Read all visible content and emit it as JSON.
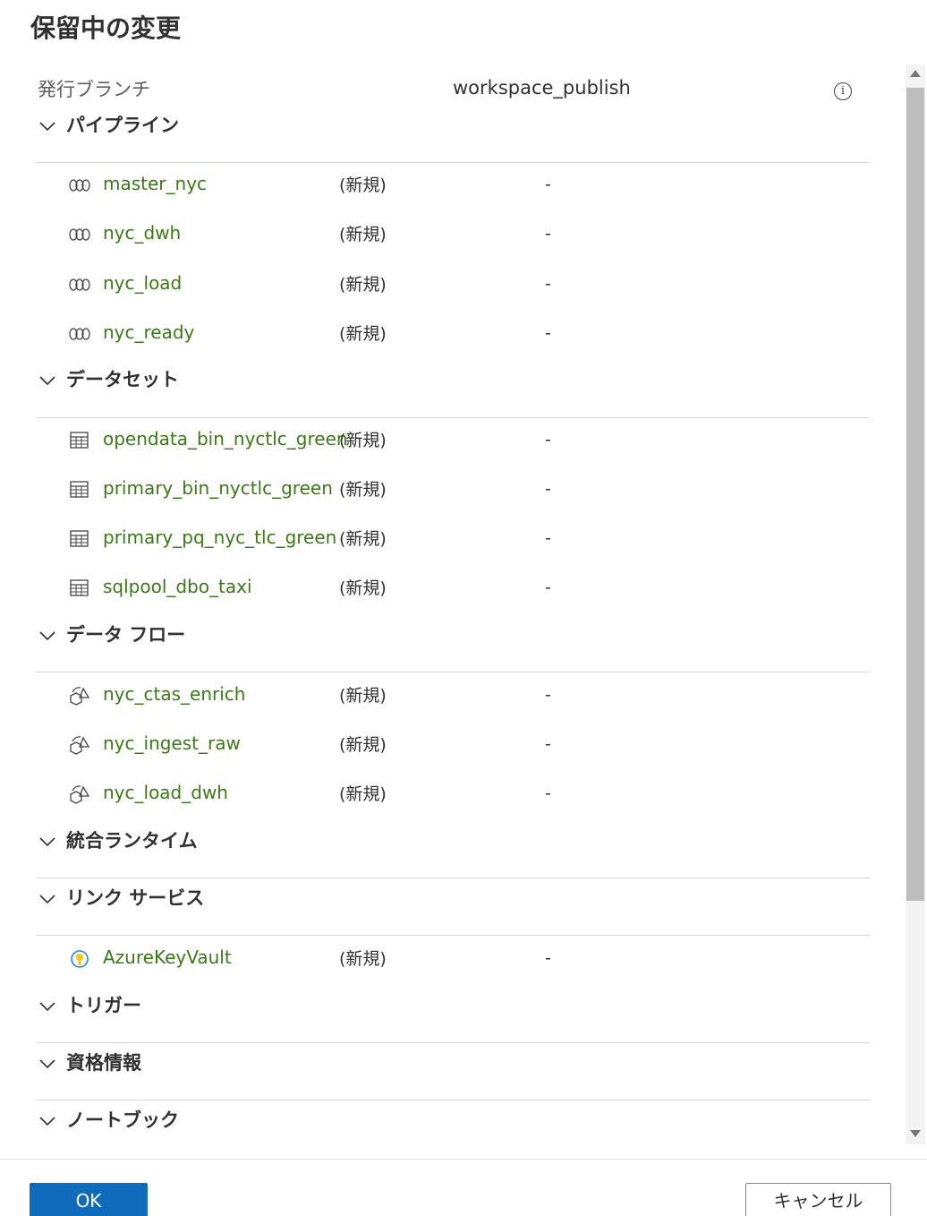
{
  "dialog": {
    "title": "保留中の変更"
  },
  "branch": {
    "label": "発行ブランチ",
    "value": "workspace_publish"
  },
  "sections": [
    {
      "title": "パイプライン",
      "items": [
        {
          "name": "master_nyc",
          "status": "(新規)",
          "detail": "-"
        },
        {
          "name": "nyc_dwh",
          "status": "(新規)",
          "detail": "-"
        },
        {
          "name": "nyc_load",
          "status": "(新規)",
          "detail": "-"
        },
        {
          "name": "nyc_ready",
          "status": "(新規)",
          "detail": "-"
        }
      ]
    },
    {
      "title": "データセット",
      "items": [
        {
          "name": "opendata_bin_nyctlc_green",
          "status": "(新規)",
          "detail": "-"
        },
        {
          "name": "primary_bin_nyctlc_green",
          "status": "(新規)",
          "detail": "-"
        },
        {
          "name": "primary_pq_nyc_tlc_green",
          "status": "(新規)",
          "detail": "-"
        },
        {
          "name": "sqlpool_dbo_taxi",
          "status": "(新規)",
          "detail": "-"
        }
      ]
    },
    {
      "title": "データ フロー",
      "items": [
        {
          "name": "nyc_ctas_enrich",
          "status": "(新規)",
          "detail": "-"
        },
        {
          "name": "nyc_ingest_raw",
          "status": "(新規)",
          "detail": "-"
        },
        {
          "name": "nyc_load_dwh",
          "status": "(新規)",
          "detail": "-"
        }
      ]
    },
    {
      "title": "統合ランタイム",
      "items": []
    },
    {
      "title": "リンク サービス",
      "items": [
        {
          "name": "AzureKeyVault",
          "status": "(新規)",
          "detail": "-"
        }
      ]
    },
    {
      "title": "トリガー",
      "items": []
    },
    {
      "title": "資格情報",
      "items": []
    },
    {
      "title": "ノートブック",
      "items": []
    }
  ],
  "icons": {
    "pipeline": "pipeline-icon",
    "dataset": "table-icon",
    "dataflow": "dataflow-icon",
    "linked_service": "key-vault-icon",
    "info": "info-icon",
    "chevron": "chevron-down-icon"
  },
  "colors": {
    "accent": "#0f6cbd",
    "item_link": "#3a7a16"
  },
  "buttons": {
    "ok": "OK",
    "cancel": "キャンセル"
  },
  "info_glyph": "i"
}
